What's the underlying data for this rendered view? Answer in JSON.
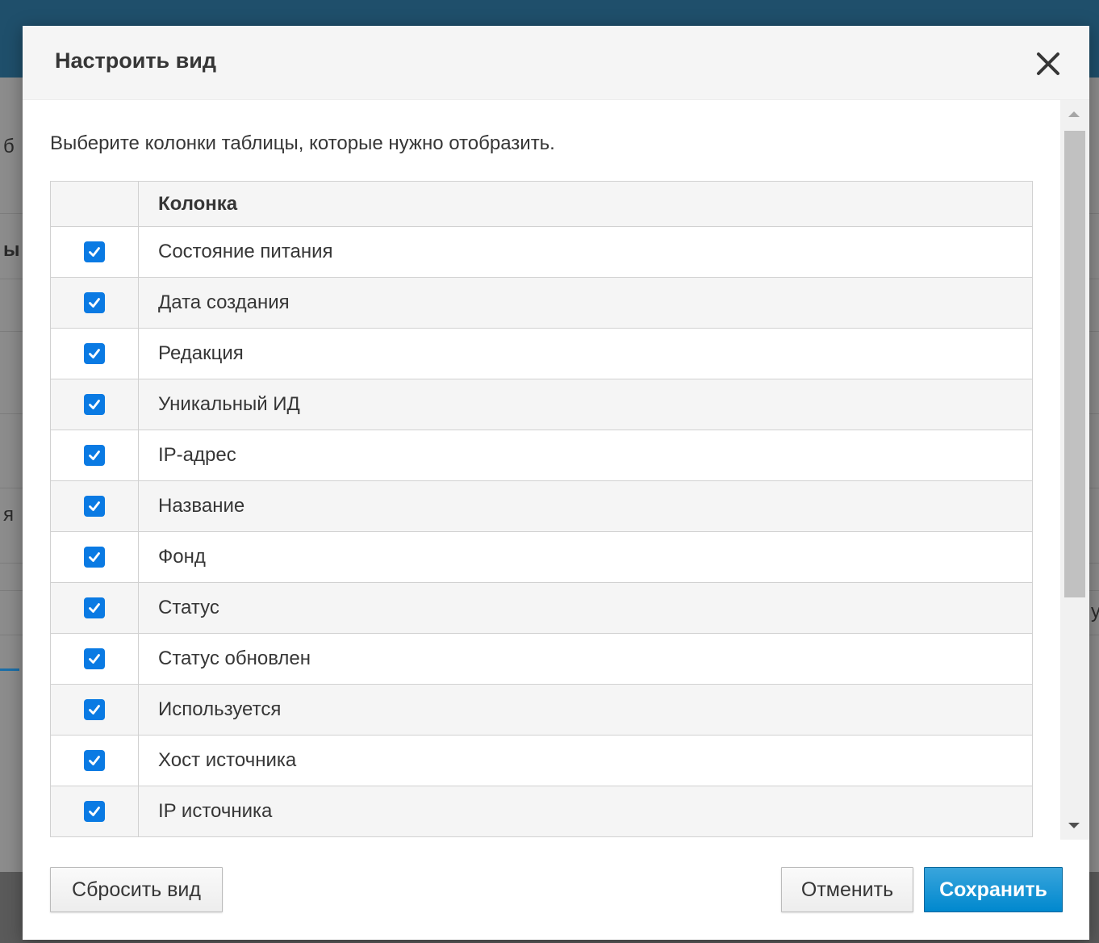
{
  "modal": {
    "title": "Настроить вид",
    "intro": "Выберите колонки таблицы, которые нужно отобразить.",
    "table_header": "Колонка",
    "columns": [
      {
        "label": "Состояние питания",
        "checked": true
      },
      {
        "label": "Дата создания",
        "checked": true
      },
      {
        "label": "Редакция",
        "checked": true
      },
      {
        "label": "Уникальный ИД",
        "checked": true
      },
      {
        "label": "IP-адрес",
        "checked": true
      },
      {
        "label": "Название",
        "checked": true
      },
      {
        "label": "Фонд",
        "checked": true
      },
      {
        "label": "Статус",
        "checked": true
      },
      {
        "label": "Статус обновлен",
        "checked": true
      },
      {
        "label": "Используется",
        "checked": true
      },
      {
        "label": "Хост источника",
        "checked": true
      },
      {
        "label": "IP источника",
        "checked": true
      }
    ],
    "buttons": {
      "reset": "Сбросить вид",
      "cancel": "Отменить",
      "save": "Сохранить"
    },
    "icons": {
      "close": "close-icon",
      "check": "checkmark-icon"
    }
  },
  "background": {
    "fragments": [
      "б",
      "ы",
      "я",
      "у"
    ]
  },
  "colors": {
    "primary": "#0088ce",
    "checkbox": "#0a7ae3",
    "header_bg": "#f5f5f5",
    "backdrop_topbar": "#1f4f6b"
  }
}
